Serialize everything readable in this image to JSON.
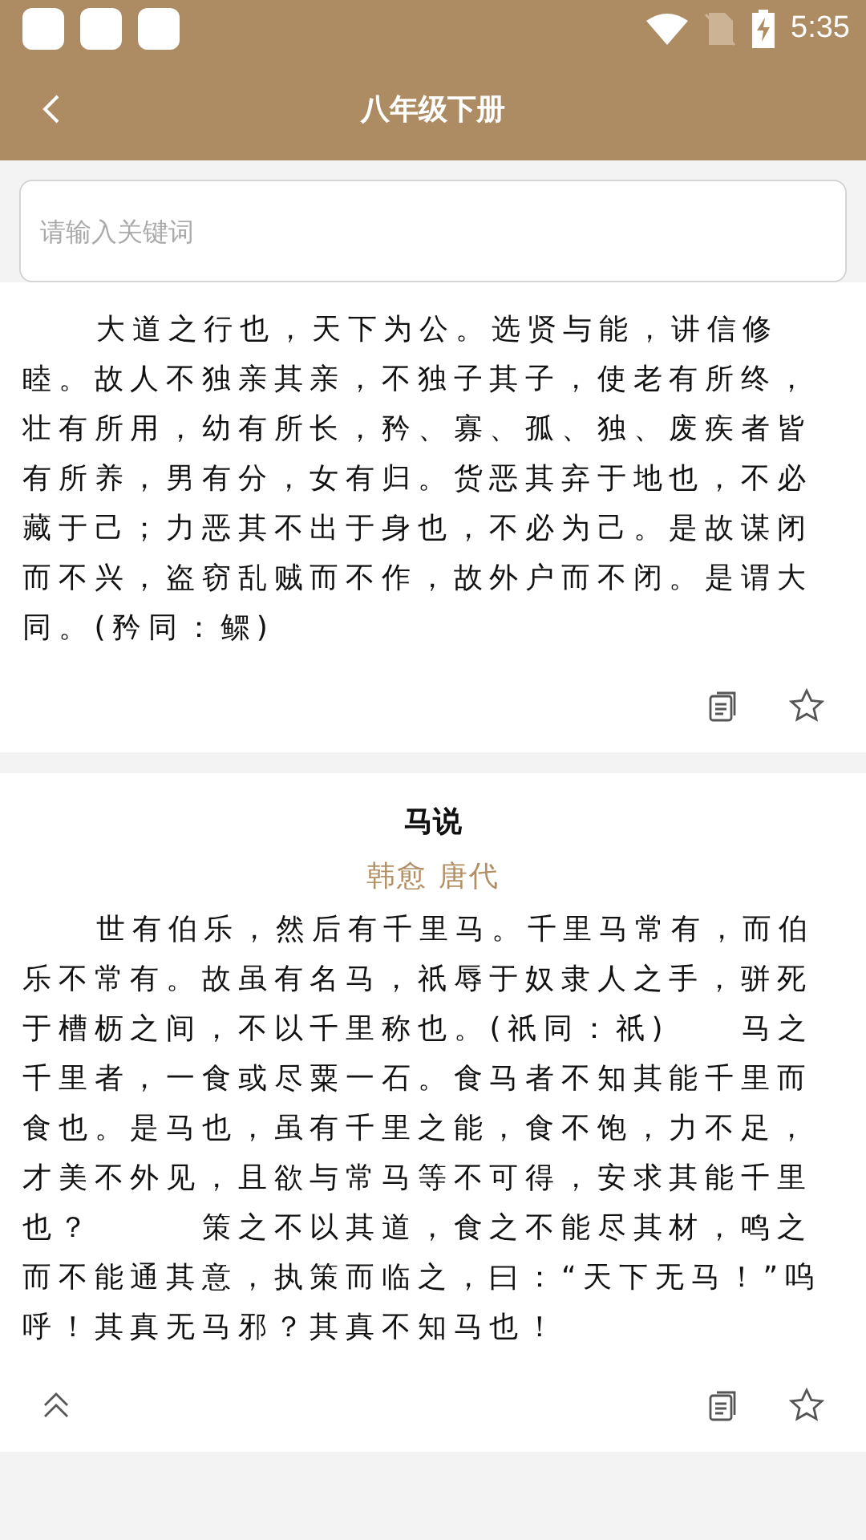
{
  "status_bar": {
    "time": "5:35"
  },
  "header": {
    "title": "八年级下册"
  },
  "search": {
    "placeholder": "请输入关键词"
  },
  "poems": [
    {
      "body": "大道之行也，天下为公。选贤与能，讲信修睦。故人不独亲其亲，不独子其子，使老有所终，壮有所用，幼有所长，矜、寡、孤、独、废疾者皆有所养，男有分，女有归。货恶其弃于地也，不必藏于己；力恶其不出于身也，不必为己。是故谋闭而不兴，盗窃乱贼而不作，故外户而不闭。是谓大同。(矜同：鳏)",
      "favorited": false
    },
    {
      "title": "马说",
      "author": "韩愈",
      "dynasty": "唐代",
      "body": "世有伯乐，然后有千里马。千里马常有，而伯乐不常有。故虽有名马，祇辱于奴隶人之手，骈死于槽枥之间，不以千里称也。(祇同：祇)　　马之千里者，一食或尽粟一石。食马者不知其能千里而食也。是马也，虽有千里之能，食不饱，力不足，才美不外见，且欲与常马等不可得，安求其能千里也？　　　策之不以其道，食之不能尽其材，鸣之而不能通其意，执策而临之，曰：“天下无马！”呜呼！其真无马邪？其真不知马也！",
      "favorited": false
    }
  ]
}
